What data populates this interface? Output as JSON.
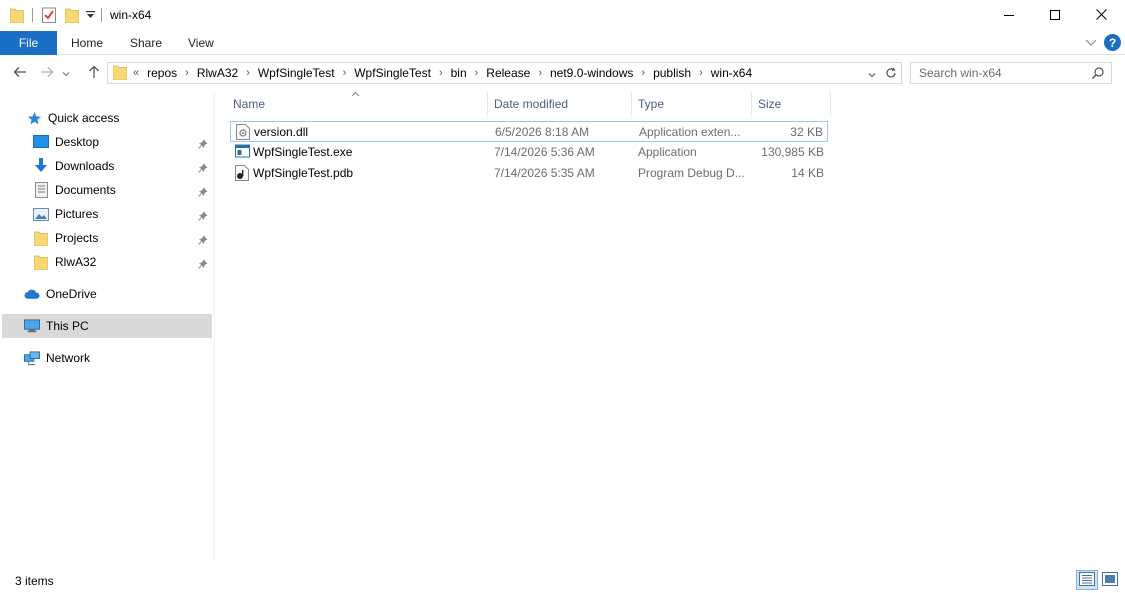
{
  "window": {
    "title": "win-x64"
  },
  "ribbon": {
    "tabs": [
      {
        "label": "File"
      },
      {
        "label": "Home"
      },
      {
        "label": "Share"
      },
      {
        "label": "View"
      }
    ]
  },
  "address": {
    "overflow": "«",
    "crumbs": [
      "repos",
      "RlwA32",
      "WpfSingleTest",
      "WpfSingleTest",
      "bin",
      "Release",
      "net9.0-windows",
      "publish",
      "win-x64"
    ],
    "separator": "›"
  },
  "search": {
    "placeholder": "Search win-x64"
  },
  "navpane": {
    "quick_access": "Quick access",
    "pinned": [
      {
        "label": "Desktop",
        "icon": "desktop-icon"
      },
      {
        "label": "Downloads",
        "icon": "downloads-icon"
      },
      {
        "label": "Documents",
        "icon": "documents-icon"
      },
      {
        "label": "Pictures",
        "icon": "pictures-icon"
      },
      {
        "label": "Projects",
        "icon": "folder-icon"
      },
      {
        "label": "RlwA32",
        "icon": "folder-icon"
      }
    ],
    "onedrive": "OneDrive",
    "this_pc": "This PC",
    "network": "Network"
  },
  "columns": {
    "name": "Name",
    "date": "Date modified",
    "type": "Type",
    "size": "Size"
  },
  "files": [
    {
      "name": "version.dll",
      "date": "6/5/2026 8:18 AM",
      "type": "Application exten...",
      "size": "32 KB",
      "icon": "dll-file-icon"
    },
    {
      "name": "WpfSingleTest.exe",
      "date": "7/14/2026 5:36 AM",
      "type": "Application",
      "size": "130,985 KB",
      "icon": "exe-file-icon"
    },
    {
      "name": "WpfSingleTest.pdb",
      "date": "7/14/2026 5:35 AM",
      "type": "Program Debug D...",
      "size": "14 KB",
      "icon": "pdb-file-icon"
    }
  ],
  "status": {
    "count": "3 items"
  },
  "colors": {
    "accent": "#1a6fc4",
    "folder": "#f8d775",
    "selection_border": "#99c9ef",
    "nav_selected": "#d9d9d9"
  }
}
